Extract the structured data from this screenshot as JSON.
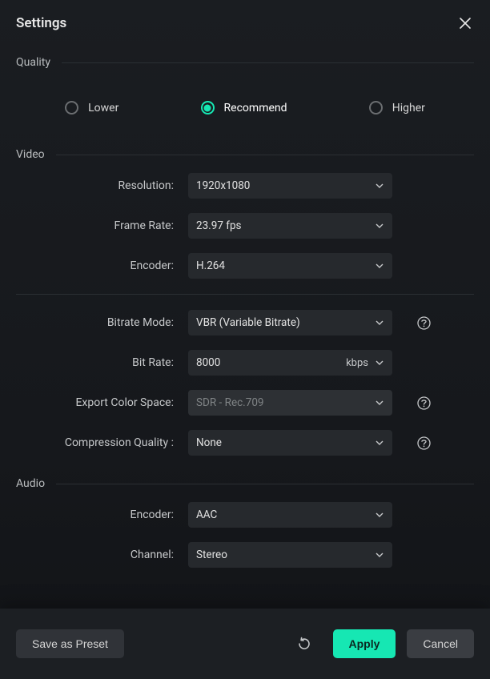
{
  "title": "Settings",
  "quality": {
    "heading": "Quality",
    "options": {
      "lower": "Lower",
      "recommend": "Recommend",
      "higher": "Higher"
    },
    "selected": "recommend"
  },
  "video": {
    "heading": "Video",
    "resolution_label": "Resolution:",
    "resolution_value": "1920x1080",
    "framerate_label": "Frame Rate:",
    "framerate_value": "23.97 fps",
    "encoder_label": "Encoder:",
    "encoder_value": "H.264",
    "bitrate_mode_label": "Bitrate Mode:",
    "bitrate_mode_value": "VBR (Variable Bitrate)",
    "bitrate_label": "Bit Rate:",
    "bitrate_value": "8000",
    "bitrate_unit": "kbps",
    "color_space_label": "Export Color Space:",
    "color_space_value": "SDR - Rec.709",
    "comp_quality_label": "Compression Quality :",
    "comp_quality_value": "None"
  },
  "audio": {
    "heading": "Audio",
    "encoder_label": "Encoder:",
    "encoder_value": "AAC",
    "channel_label": "Channel:",
    "channel_value": "Stereo"
  },
  "footer": {
    "save_preset": "Save as Preset",
    "apply": "Apply",
    "cancel": "Cancel"
  }
}
